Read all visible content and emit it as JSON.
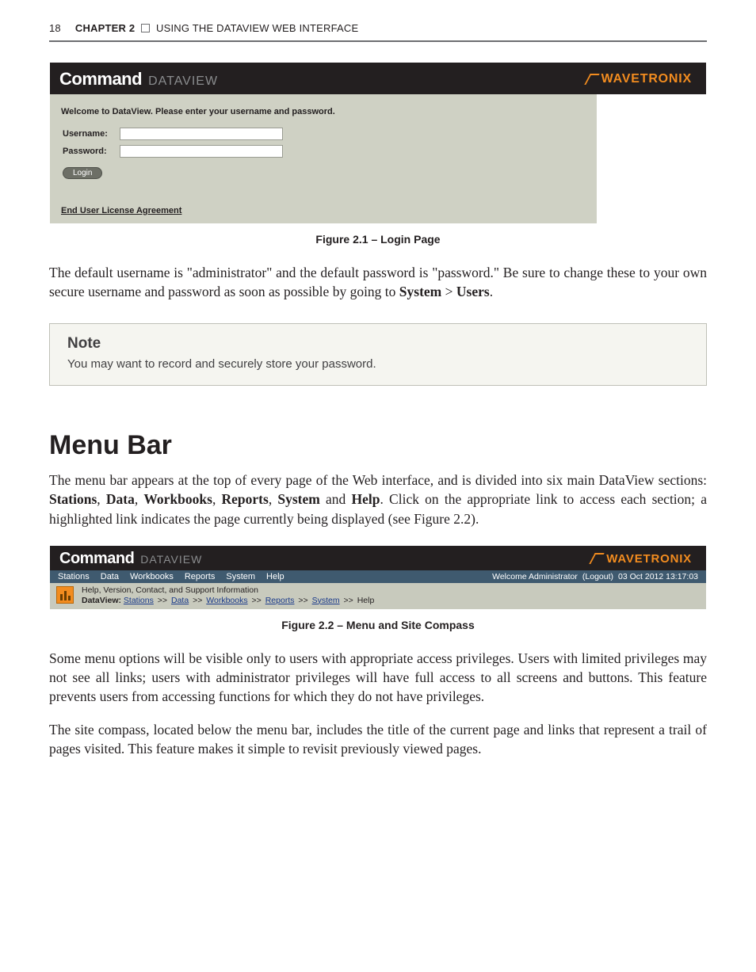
{
  "running_head": {
    "page_number": "18",
    "chapter_label": "CHAPTER 2",
    "chapter_title": "USING THE DATAVIEW WEB INTERFACE"
  },
  "brand": {
    "command": "Command",
    "dataview": "DATAVIEW",
    "wavetronix": "WAVETRONIX"
  },
  "login": {
    "welcome": "Welcome to DataView. Please enter your username and password.",
    "username_label": "Username:",
    "password_label": "Password:",
    "login_button": "Login",
    "eula": "End User License Agreement"
  },
  "fig1_caption": "Figure 2.1 – Login Page",
  "para1_a": "The default username is \"administrator\" and the default password is \"password.\" Be sure to change these to your own secure username and password as soon as possible by going to ",
  "para1_b_bold": "System",
  "para1_c": " > ",
  "para1_d_bold": "Users",
  "para1_e": ".",
  "note": {
    "title": "Note",
    "text": "You may want to record and securely store your password."
  },
  "menu_bar_heading": "Menu Bar",
  "para2_a": "The menu bar appears at the top of every page of the Web interface, and is divided into six main DataView sections: ",
  "para2_sections": [
    "Stations",
    "Data",
    "Workbooks",
    "Reports",
    "System",
    "Help"
  ],
  "para2_join_comma": ", ",
  "para2_join_and": " and ",
  "para2_b": ". Click on the appropriate link to access each section; a highlighted link indicates the page currently being displayed (see Figure 2.2).",
  "menubar": {
    "items": [
      "Stations",
      "Data",
      "Workbooks",
      "Reports",
      "System",
      "Help"
    ],
    "welcome": "Welcome Administrator",
    "logout": "(Logout)",
    "timestamp": "03 Oct 2012 13:17:03"
  },
  "crumb": {
    "line1": "Help, Version, Contact, and Support Information",
    "prefix": "DataView:",
    "trail": [
      "Stations",
      "Data",
      "Workbooks",
      "Reports",
      "System"
    ],
    "tail": "Help",
    "sep": ">>"
  },
  "fig2_caption": "Figure 2.2 – Menu and Site Compass",
  "para3": "Some menu options will be visible only to users with appropriate access privileges. Users with limited privileges may not see all links; users with administrator privileges will have full access to all screens and buttons. This feature prevents users from accessing functions for which they do not have privileges.",
  "para4": "The site compass, located below the menu bar, includes the title of the current page and links that represent a trail of pages visited. This feature makes it simple to revisit previously viewed pages."
}
